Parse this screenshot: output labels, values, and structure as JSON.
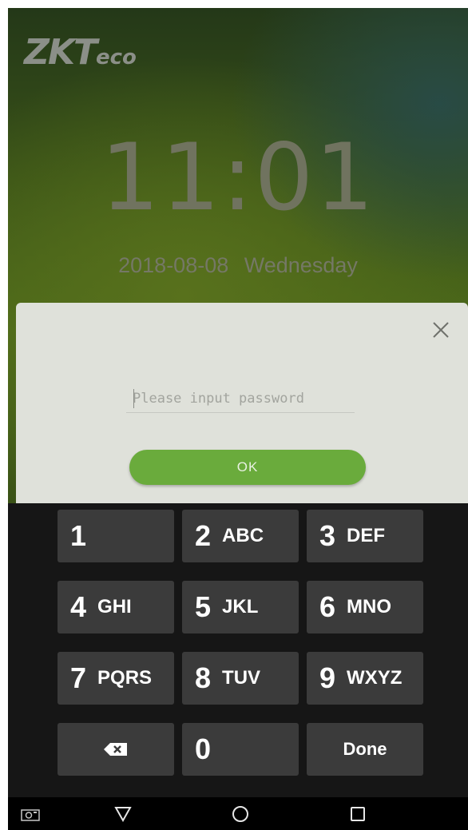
{
  "lockscreen": {
    "logo_main": "ZKT",
    "logo_small": "eco",
    "time": "11:01",
    "date": "2018-08-08",
    "weekday": "Wednesday"
  },
  "dialog": {
    "password_placeholder": "Please input password",
    "password_value": "",
    "ok_label": "OK"
  },
  "keypad": {
    "keys": [
      {
        "num": "1",
        "letters": ""
      },
      {
        "num": "2",
        "letters": "ABC"
      },
      {
        "num": "3",
        "letters": "DEF"
      },
      {
        "num": "4",
        "letters": "GHI"
      },
      {
        "num": "5",
        "letters": "JKL"
      },
      {
        "num": "6",
        "letters": "MNO"
      },
      {
        "num": "7",
        "letters": "PQRS"
      },
      {
        "num": "8",
        "letters": "TUV"
      },
      {
        "num": "9",
        "letters": "WXYZ"
      },
      {
        "num": "0",
        "letters": ""
      }
    ],
    "done_label": "Done",
    "backspace_icon": "backspace-icon"
  },
  "navbar": {
    "icons": [
      "screenshot-icon",
      "back-triangle-icon",
      "home-circle-icon",
      "recents-square-icon"
    ]
  },
  "colors": {
    "ok_button": "#6aab3c",
    "key_background": "#3b3b3b",
    "keypad_background": "#161616",
    "dialog_background": "#dfe1da"
  }
}
